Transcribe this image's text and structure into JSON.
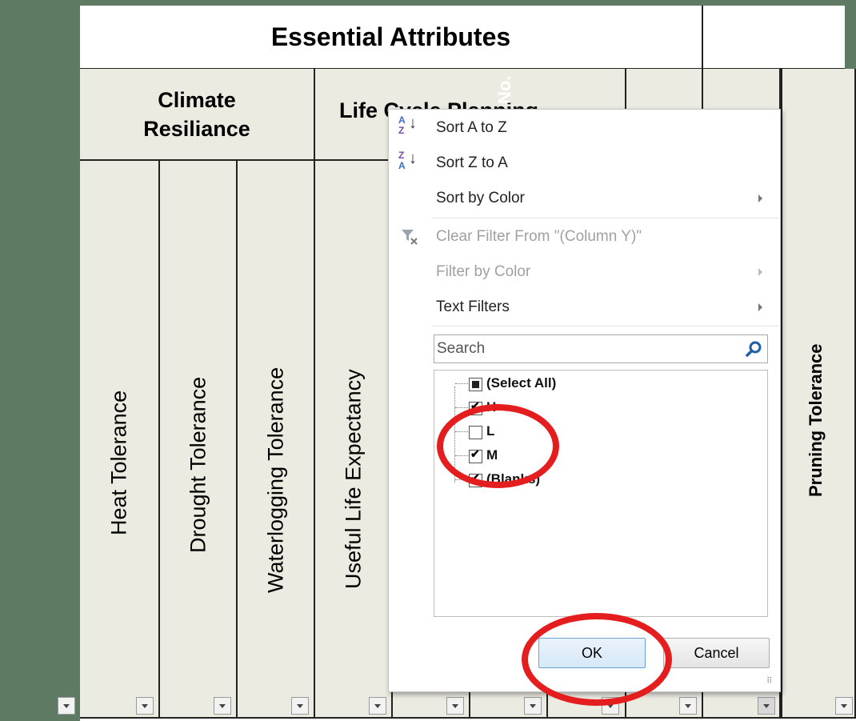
{
  "sheet": {
    "title": "Essential Attributes",
    "groups": {
      "climate": "Climate Resiliance",
      "lifecycle_partial": "Life Cycle Planning",
      "other_partial": "No."
    },
    "columns": {
      "heat": "Heat Tolerance",
      "drought": "Drought Tolerance",
      "waterlogging": "Waterlogging Tolerance",
      "useful_life": "Useful Life Expectancy",
      "pruning": "Pruning Tolerance"
    }
  },
  "filter_menu": {
    "sort_a_z": "Sort A to Z",
    "sort_z_a": "Sort Z to A",
    "sort_by_color": "Sort by Color",
    "clear_filter": "Clear Filter From \"(Column Y)\"",
    "filter_by_color": "Filter by Color",
    "text_filters": "Text Filters",
    "search_placeholder": "Search",
    "items": [
      {
        "label": "(Select All)",
        "state": "partial"
      },
      {
        "label": "H",
        "state": "checked"
      },
      {
        "label": "L",
        "state": "unchecked"
      },
      {
        "label": "M",
        "state": "checked"
      },
      {
        "label": "(Blanks)",
        "state": "checked"
      }
    ],
    "ok": "OK",
    "cancel": "Cancel"
  },
  "colors": {
    "sheet_green": "#5f7a62",
    "header_beige": "#ecebe2",
    "annotation_red": "#e41e1e"
  },
  "icons": [
    "sort-a-z-icon",
    "sort-z-a-icon",
    "clear-filter-icon",
    "search-icon",
    "dropdown-arrow-icon",
    "submenu-arrow-icon"
  ]
}
